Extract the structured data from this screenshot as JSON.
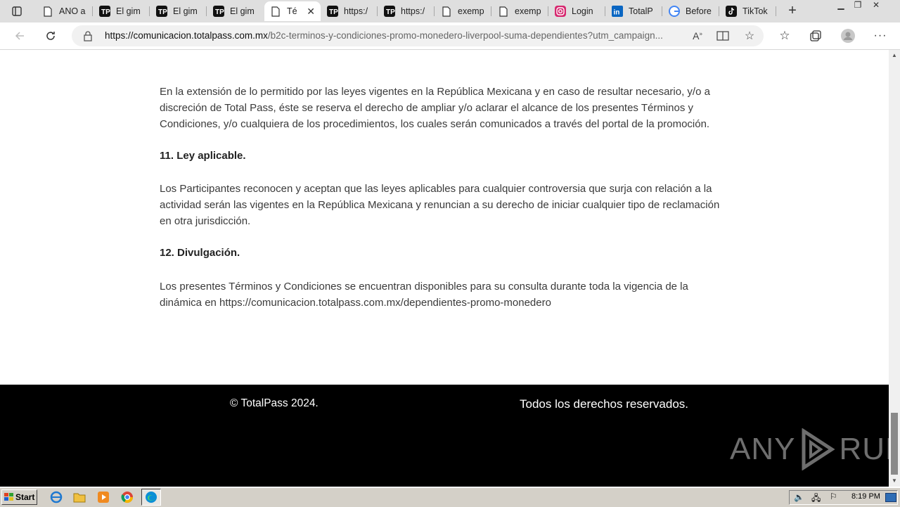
{
  "browser": {
    "tabs": [
      {
        "label": "ANO a",
        "icon": "document-icon"
      },
      {
        "label": "El gim",
        "icon": "totalpass-icon"
      },
      {
        "label": "El gim",
        "icon": "totalpass-icon"
      },
      {
        "label": "El gim",
        "icon": "totalpass-icon"
      },
      {
        "label": "Té",
        "icon": "document-icon",
        "active": true
      },
      {
        "label": "https:/",
        "icon": "totalpass-icon"
      },
      {
        "label": "https:/",
        "icon": "totalpass-icon"
      },
      {
        "label": "exemp",
        "icon": "document-icon"
      },
      {
        "label": "exemp",
        "icon": "document-icon"
      },
      {
        "label": "Login",
        "icon": "instagram-icon"
      },
      {
        "label": "TotalP",
        "icon": "linkedin-icon"
      },
      {
        "label": "Before",
        "icon": "google-icon"
      },
      {
        "label": "TikTok",
        "icon": "tiktok-icon"
      }
    ],
    "url_host": "https://comunicacion.totalpass.com.mx",
    "url_path": "/b2c-terminos-y-condiciones-promo-monedero-liverpool-suma-dependientes?utm_campaign..."
  },
  "content": {
    "paragraph_1": "En la extensión de lo permitido por las leyes vigentes en la República Mexicana y en caso de resultar necesario, y/o a discreción de Total Pass, éste se reserva el derecho de ampliar y/o aclarar el alcance de los presentes Términos y Condiciones, y/o cualquiera de los procedimientos, los cuales serán comunicados a través del portal de la promoción.",
    "heading_11": "11. Ley aplicable.",
    "paragraph_11": "Los Participantes reconocen y aceptan que las leyes aplicables para cualquier controversia que surja con relación a la actividad serán las vigentes en la República Mexicana y renuncian a su derecho de iniciar cualquier tipo de reclamación en otra jurisdicción.",
    "heading_12": "12. Divulgación.",
    "paragraph_12": "Los presentes Términos y Condiciones se encuentran disponibles para su consulta durante toda la vigencia de la dinámica en https://comunicacion.totalpass.com.mx/dependientes-promo-monedero"
  },
  "footer": {
    "copyright": "© TotalPass 2024.",
    "rights": "Todos los derechos reservados."
  },
  "watermark": {
    "left": "ANY",
    "right": "RUN"
  },
  "taskbar": {
    "start_label": "Start",
    "clock": "8:19 PM"
  },
  "colors": {
    "accent_totalpass": "#111111",
    "footer_bg": "#000000"
  }
}
